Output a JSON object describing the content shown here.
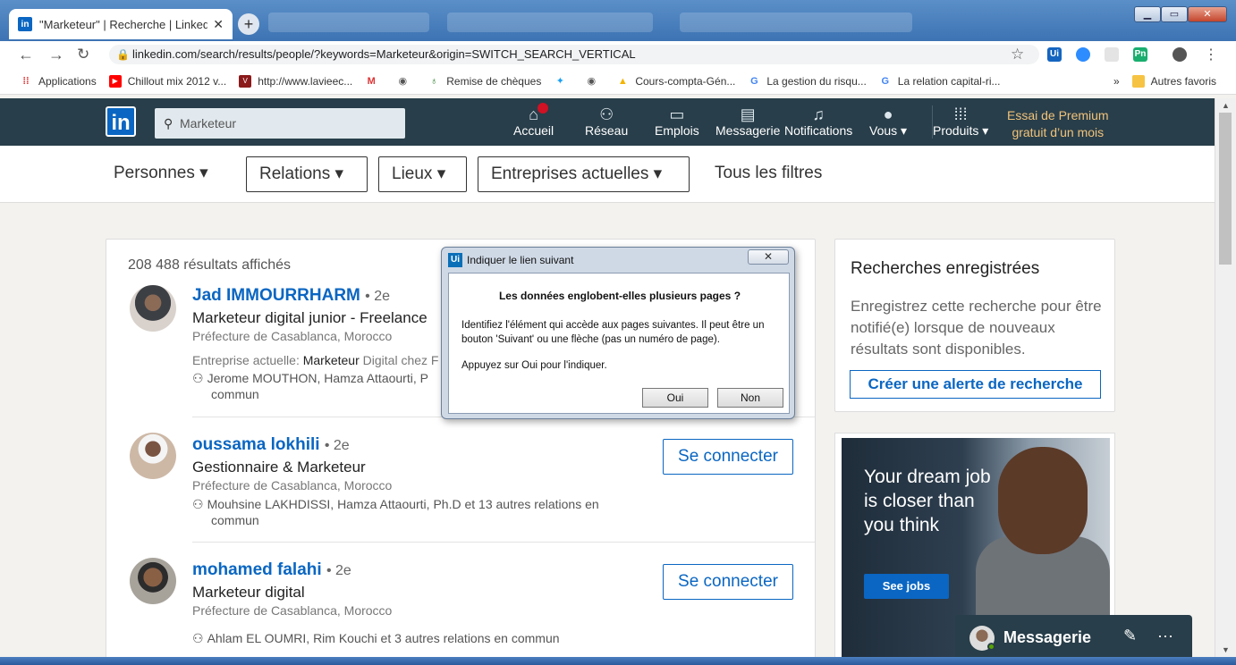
{
  "browser": {
    "tab_title": "\"Marketeur\" | Recherche | Linked",
    "tab_close": "✕",
    "new_tab": "+",
    "url": "linkedin.com/search/results/people/?keywords=Marketeur&origin=SWITCH_SEARCH_VERTICAL",
    "extensions": {
      "ui": "Ui",
      "pn": "Pn"
    },
    "window_controls": {
      "minimize": "▁",
      "maximize": "▭",
      "close": "✕"
    }
  },
  "bookmarks": [
    {
      "label": "Applications",
      "icon": "apps-grid-icon"
    },
    {
      "label": "Chillout mix 2012 v...",
      "icon": "youtube-icon"
    },
    {
      "label": "http://www.lavieec...",
      "icon": "site-icon"
    },
    {
      "label": "",
      "icon": "gmail-icon"
    },
    {
      "label": "",
      "icon": "globe-icon"
    },
    {
      "label": "Remise de chèques",
      "icon": "money-bag-icon"
    },
    {
      "label": "",
      "icon": "twitter-icon"
    },
    {
      "label": "",
      "icon": "globe-icon"
    },
    {
      "label": "Cours-compta-Gén...",
      "icon": "drive-icon"
    },
    {
      "label": "La gestion du risqu...",
      "icon": "google-icon"
    },
    {
      "label": "La relation capital-ri...",
      "icon": "google-icon"
    }
  ],
  "bookmarks_more": "»",
  "bookmarks_other": "Autres favoris",
  "linkedin": {
    "logo": "in",
    "search_value": "Marketeur",
    "nav": [
      {
        "label": "Accueil",
        "icon": "home-icon"
      },
      {
        "label": "Réseau",
        "icon": "network-icon"
      },
      {
        "label": "Emplois",
        "icon": "briefcase-icon"
      },
      {
        "label": "Messagerie",
        "icon": "messaging-icon"
      },
      {
        "label": "Notifications",
        "icon": "bell-icon"
      },
      {
        "label": "Vous ▾",
        "icon": "avatar-icon"
      },
      {
        "label": "Produits ▾",
        "icon": "grid-icon"
      }
    ],
    "premium_line1": "Essai de Premium",
    "premium_line2": "gratuit d’un mois"
  },
  "filters": [
    {
      "label": "Personnes ▾"
    },
    {
      "label": "Relations ▾"
    },
    {
      "label": "Lieux ▾"
    },
    {
      "label": "Entreprises actuelles ▾"
    },
    {
      "label": "Tous les filtres"
    }
  ],
  "results": {
    "count": "208 488 résultats affichés",
    "people": [
      {
        "name": "Jad IMMOURRHARM",
        "degree": "• 2e",
        "title": "Marketeur digital junior - Freelance",
        "location": "Préfecture de Casablanca, Morocco",
        "extra_prefix": "Entreprise actuelle: ",
        "extra_bold": "Marketeur",
        "extra_rest": " Digital chez F",
        "relations": "Jerome MOUTHON, Hamza Attaourti, P",
        "relations_2": "commun",
        "connect": ""
      },
      {
        "name": "oussama lokhili",
        "degree": "• 2e",
        "title": "Gestionnaire & Marketeur",
        "location": "Préfecture de Casablanca, Morocco",
        "relations": "Mouhsine LAKHDISSI, Hamza Attaourti, Ph.D et 13 autres relations en",
        "relations_2": "commun",
        "connect": "Se connecter"
      },
      {
        "name": "mohamed falahi",
        "degree": "• 2e",
        "title": "Marketeur digital",
        "location": "Préfecture de Casablanca, Morocco",
        "relations": "Ahlam EL OUMRI, Rim Kouchi et 3 autres relations en commun",
        "connect": "Se connecter"
      }
    ]
  },
  "saved_search": {
    "title": "Recherches enregistrées",
    "description": "Enregistrez cette recherche pour être notifié(e) lorsque de nouveaux résultats sont disponibles.",
    "button": "Créer une alerte de recherche"
  },
  "ad": {
    "text": "Your dream job is closer than you think",
    "button": "See jobs"
  },
  "messaging": {
    "label": "Messagerie",
    "compose_icon": "✎",
    "more_icon": "···"
  },
  "dialog": {
    "title": "Indiquer le lien suivant",
    "icon_text": "Ui",
    "close": "✕",
    "heading": "Les données englobent-elles plusieurs pages ?",
    "body": "Identifiez l'élément qui accède aux pages suivantes. Il peut être un bouton 'Suivant' ou une flèche (pas un numéro de page).",
    "instruction": "Appuyez sur Oui pour l'indiquer.",
    "yes": "Oui",
    "no": "Non"
  }
}
